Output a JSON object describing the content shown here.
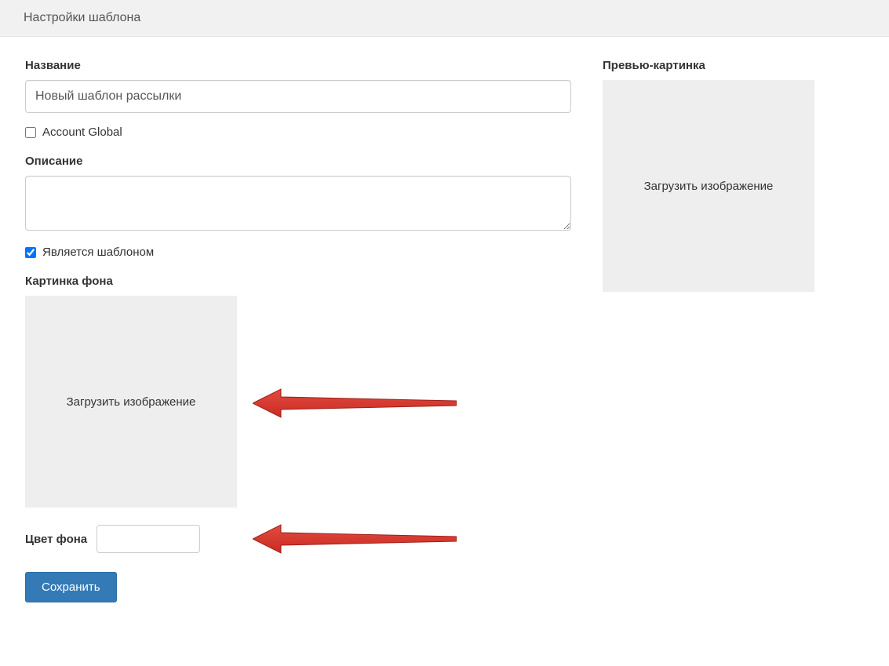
{
  "header": {
    "title": "Настройки шаблона"
  },
  "fields": {
    "name_label": "Название",
    "name_value": "Новый шаблон рассылки",
    "account_global_label": "Account Global",
    "account_global_checked": false,
    "description_label": "Описание",
    "description_value": "",
    "is_template_label": "Является шаблоном",
    "is_template_checked": true,
    "bg_image_label": "Картинка фона",
    "upload_text": "Загрузить изображение",
    "bg_color_label": "Цвет фона",
    "bg_color_value": ""
  },
  "preview": {
    "label": "Превью-картинка",
    "upload_text": "Загрузить изображение"
  },
  "actions": {
    "save": "Сохранить"
  },
  "annotations": {
    "arrow_color": "#d9342b"
  }
}
